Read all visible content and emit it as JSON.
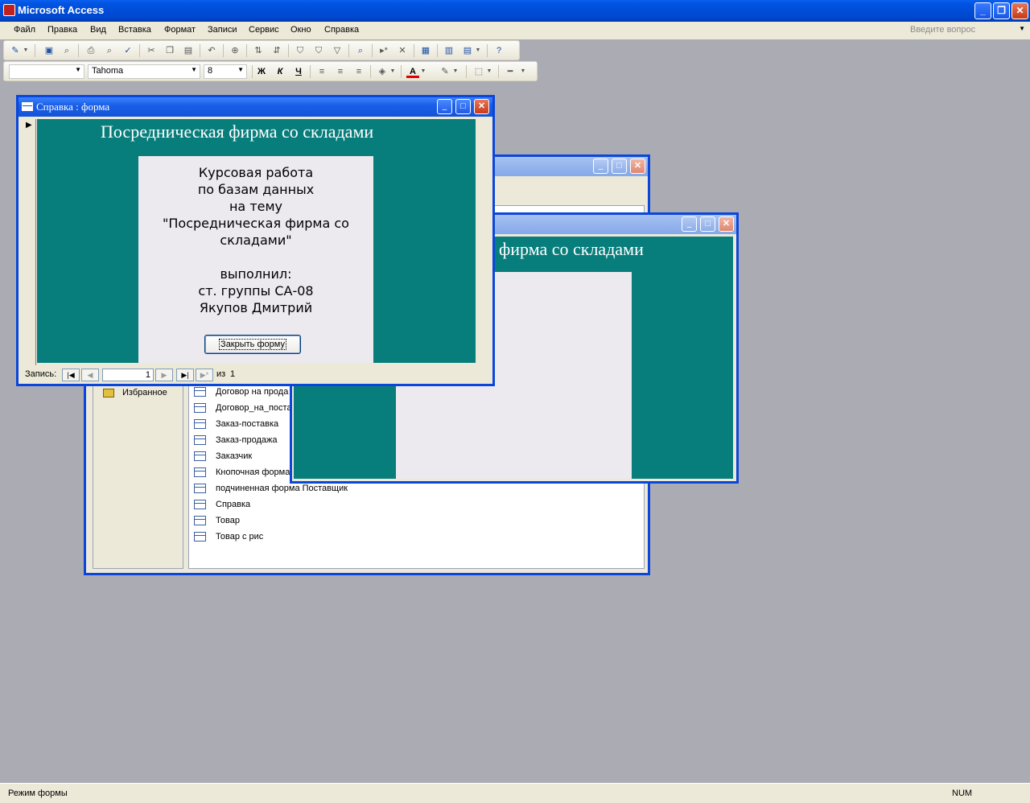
{
  "app": {
    "title": "Microsoft Access"
  },
  "menu": [
    "Файл",
    "Правка",
    "Вид",
    "Вставка",
    "Формат",
    "Записи",
    "Сервис",
    "Окно",
    "Справка"
  ],
  "help_box": {
    "placeholder": "Введите вопрос"
  },
  "format_bar": {
    "font": "Tahoma",
    "size": "8",
    "bold": "Ж",
    "italic": "К",
    "underline": "Ч"
  },
  "db_window": {
    "groups": [
      "Избранное"
    ],
    "forms": [
      "Договор на прода",
      "Договор_на_поста",
      "Заказ-поставка",
      "Заказ-продажа",
      "Заказчик",
      "Кнопочная форма",
      "подчиненная форма Поставщик",
      "Справка",
      "Товар",
      "Товар с рис"
    ]
  },
  "main_form": {
    "title_partial": "фирма со складами"
  },
  "spravka": {
    "window_title": "Справка : форма",
    "heading": "Посредническая фирма со складами",
    "lines": [
      "Курсовая работа",
      "по базам данных",
      "на тему",
      "\"Посредническая фирма со",
      "складами\"",
      "",
      "выполнил:",
      "ст. группы СА-08",
      "Якупов Дмитрий"
    ],
    "close_button": "Закрыть форму",
    "nav": {
      "label": "Запись:",
      "current": "1",
      "of": "из",
      "total": "1"
    }
  },
  "status": {
    "mode": "Режим формы",
    "num": "NUM"
  },
  "colors": {
    "form_bg": "#087e7c",
    "titlebar": "#0a5ff0"
  }
}
